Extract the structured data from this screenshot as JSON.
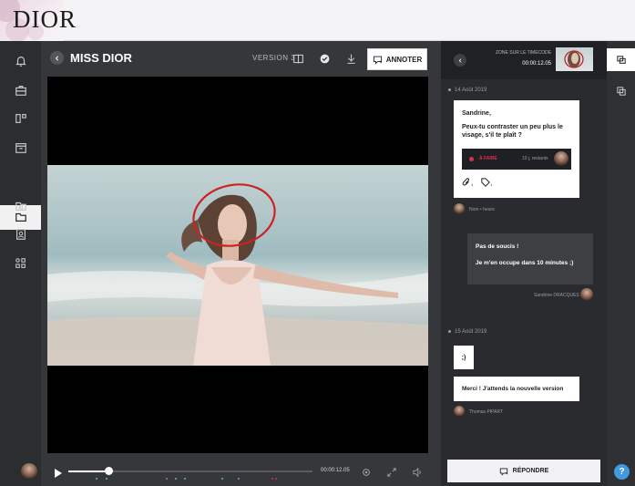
{
  "brand": {
    "logo": "DIOR"
  },
  "nav": {
    "icons": [
      "bell-icon",
      "briefcase-icon",
      "dashboard-icon",
      "calendar-icon",
      "folder-icon",
      "folder-badge-icon",
      "contacts-icon",
      "modules-icon"
    ]
  },
  "header": {
    "title": "MISS DIOR",
    "version": "VERSION 3",
    "annotate_label": "ANNOTER"
  },
  "player": {
    "timecode": "00:00:12.05",
    "progress": 0.15
  },
  "panel": {
    "zone_label": "ZONE SUR LE TIMECODE",
    "zone_time": "00:00:12.05",
    "date1": "14 Août 2019",
    "comment1": {
      "name": "Sandrine,",
      "text": "Peux-tu contraster un peu plus le visage, s'il te plaît ?",
      "status": "À FAIRE",
      "due": "10 j, restants",
      "links_count": "1",
      "tags_count": "1",
      "author": "Nom • heure"
    },
    "reply1": {
      "line1": "Pas de soucis !",
      "line2": "Je m'en occupe dans 10 minutes ;)",
      "author": "Sandrine DRACQUES"
    },
    "date2": "15 Août 2019",
    "comment2": {
      "text": ";)"
    },
    "comment3": {
      "text": "Merci ! J'attends la nouvelle version",
      "author": "Thomas PIPART"
    },
    "reply_label": "RÉPONDRE"
  },
  "help": {
    "label": "?"
  },
  "colors": {
    "accent_red": "#e0314a",
    "annotation_red": "#cc2222",
    "help_blue": "#3f9ae0"
  }
}
